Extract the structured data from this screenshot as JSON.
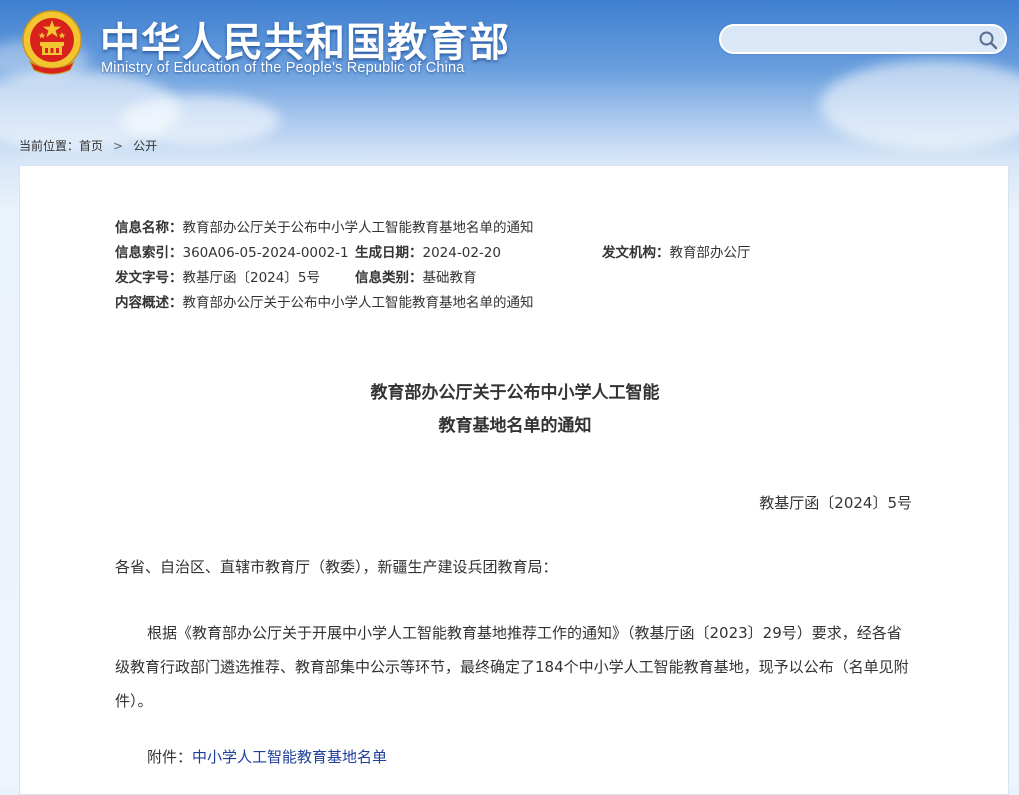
{
  "header": {
    "title": "中华人民共和国教育部",
    "subtitle": "Ministry of Education of the People's Republic of China",
    "search": {
      "placeholder": "",
      "value": ""
    }
  },
  "breadcrumb": {
    "prefix": "当前位置：",
    "home": "首页",
    "separator": ">",
    "current": "公开"
  },
  "meta": {
    "name_key": "信息名称：",
    "name_val": "教育部办公厅关于公布中小学人工智能教育基地名单的通知",
    "index_key": "信息索引：",
    "index_val": "360A06-05-2024-0002-1",
    "date_key": "生成日期：",
    "date_val": "2024-02-20",
    "org_key": "发文机构：",
    "org_val": "教育部办公厅",
    "docno_key": "发文字号：",
    "docno_val": "教基厅函〔2024〕5号",
    "category_key": "信息类别：",
    "category_val": "基础教育",
    "summary_key": "内容概述：",
    "summary_val": "教育部办公厅关于公布中小学人工智能教育基地名单的通知"
  },
  "document": {
    "title_line1": "教育部办公厅关于公布中小学人工智能",
    "title_line2": "教育基地名单的通知",
    "number": "教基厅函〔2024〕5号",
    "salutation": "各省、自治区、直辖市教育厅（教委），新疆生产建设兵团教育局：",
    "body": "根据《教育部办公厅关于开展中小学人工智能教育基地推荐工作的通知》（教基厅函〔2023〕29号）要求，经各省级教育行政部门遴选推荐、教育部集中公示等环节，最终确定了184个中小学人工智能教育基地，现予以公布（名单见附件）。",
    "attachment_label": "附件：",
    "attachment_link": "中小学人工智能教育基地名单"
  },
  "colors": {
    "header_blue": "#3f7fd0",
    "emblem_red": "#d8201c",
    "emblem_gold": "#f2c531",
    "link_blue": "#1e3f9a"
  },
  "icons": {
    "emblem": "national-emblem-icon",
    "search": "search-icon"
  }
}
